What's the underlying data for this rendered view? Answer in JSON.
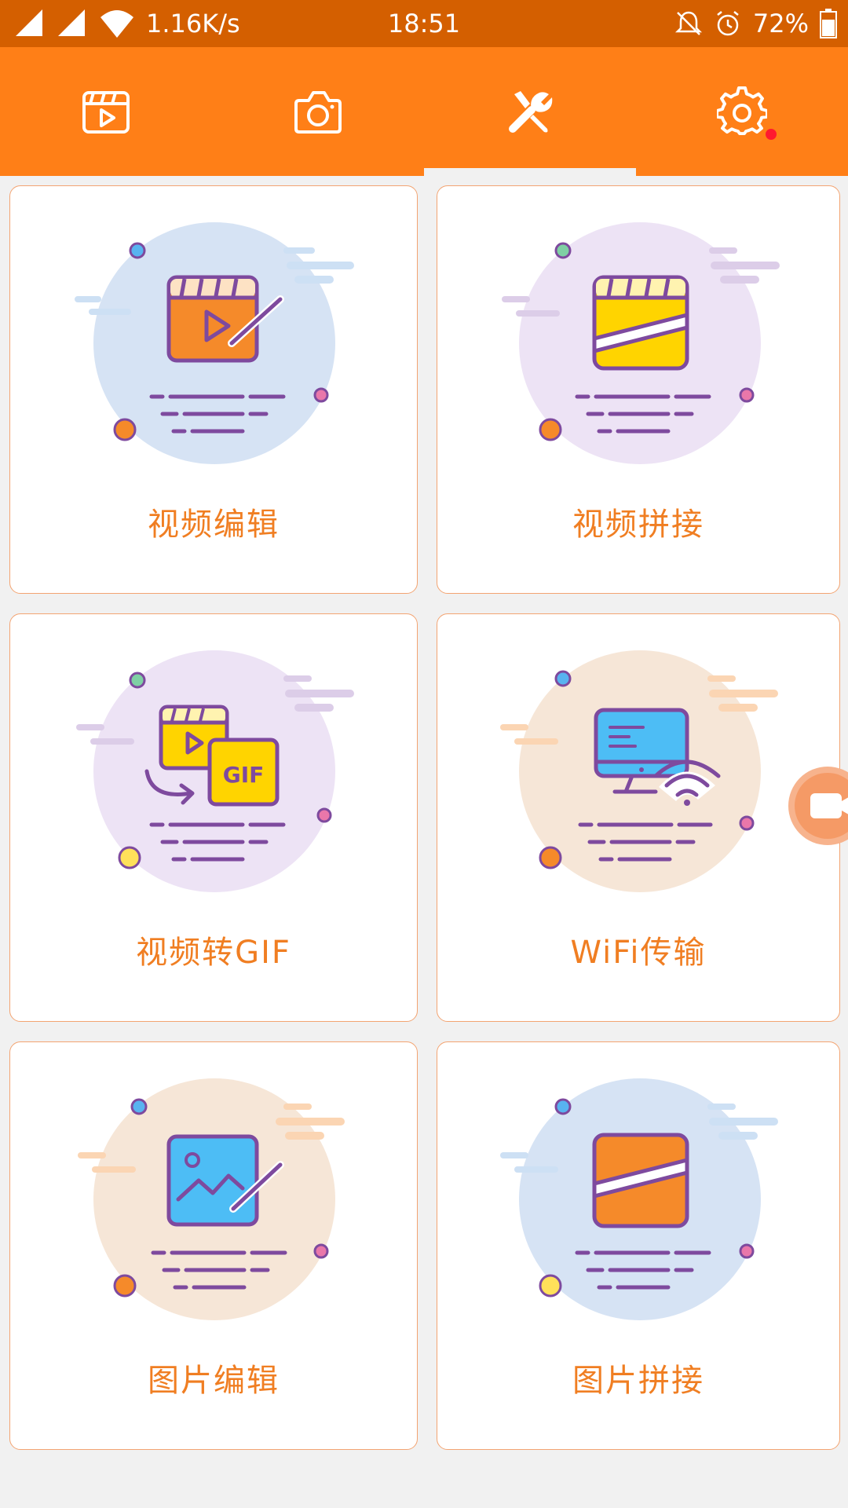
{
  "status_bar": {
    "speed": "1.16K/s",
    "time": "18:51",
    "battery": "72%"
  },
  "tabs": [
    {
      "name": "video-list",
      "icon": "video-clapper-icon"
    },
    {
      "name": "camera",
      "icon": "camera-icon"
    },
    {
      "name": "tools",
      "icon": "tools-icon",
      "selected": true
    },
    {
      "name": "settings",
      "icon": "gear-icon",
      "badge": true
    }
  ],
  "cards": [
    {
      "label": "视频编辑",
      "icon": "video-edit-icon"
    },
    {
      "label": "视频拼接",
      "icon": "video-merge-icon"
    },
    {
      "label": "视频转GIF",
      "icon": "video-to-gif-icon"
    },
    {
      "label": "WiFi传输",
      "icon": "wifi-transfer-icon"
    },
    {
      "label": "图片编辑",
      "icon": "image-edit-icon"
    },
    {
      "label": "图片拼接",
      "icon": "image-merge-icon"
    }
  ],
  "gif_badge": "GIF",
  "colors": {
    "status_bar": "#d45f00",
    "toolbar": "#ff7f17",
    "accent_text": "#f07e22",
    "card_border": "#f3a472",
    "icon_outline": "#7e4a9e"
  }
}
